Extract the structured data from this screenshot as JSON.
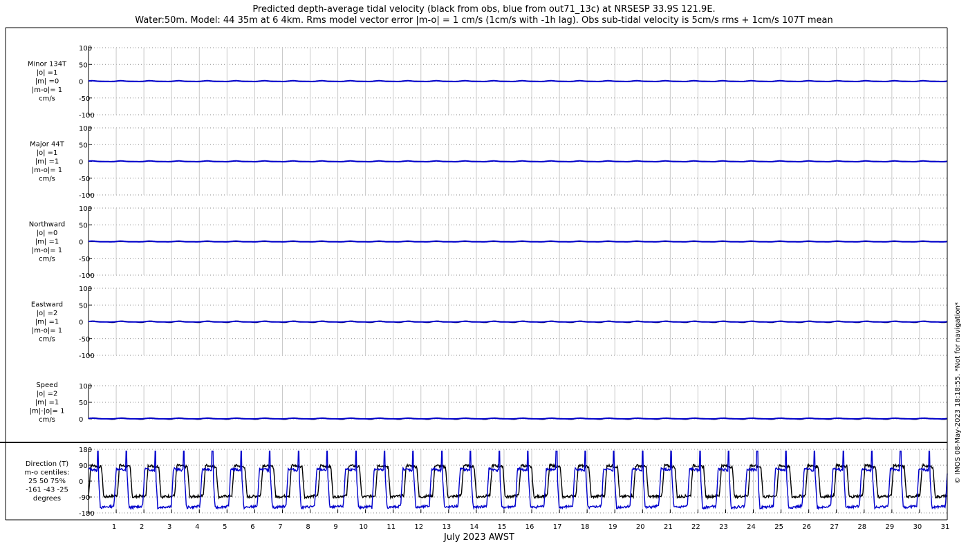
{
  "title": {
    "line1": "Predicted depth-average tidal velocity (black from obs, blue from out71_13c) at NRSESP 33.9S 121.9E.",
    "line2": "Water:50m. Model: 44 35m at 6 4km. Rms model vector error |m-o| = 1 cm/s (1cm/s with -1h lag). Obs sub-tidal velocity is 5cm/s rms + 1cm/s 107T mean"
  },
  "xlabel": "July 2023 AWST",
  "credit": "© IMOS 08-May-2023 18:18:55. *Not for navigation*",
  "colors": {
    "obs": "#000000",
    "model": "#0000cc",
    "grid": "#888888"
  },
  "chart_data": [
    {
      "type": "line",
      "name": "minor",
      "label_lines": [
        "Minor 134T",
        "|o| =1",
        "|m| =0",
        "|m-o|= 1",
        "cm/s"
      ],
      "ylim": [
        -100,
        100
      ],
      "yticks": [
        -100,
        -50,
        0,
        50,
        100
      ],
      "xlim": [
        0,
        31
      ],
      "xticks": [
        1,
        2,
        3,
        4,
        5,
        6,
        7,
        8,
        9,
        10,
        11,
        12,
        13,
        14,
        15,
        16,
        17,
        18,
        19,
        20,
        21,
        22,
        23,
        24,
        25,
        26,
        27,
        28,
        29,
        30,
        31
      ],
      "series": [
        {
          "role": "obs",
          "amplitude": 1
        },
        {
          "role": "model",
          "amplitude": 1
        }
      ]
    },
    {
      "type": "line",
      "name": "major",
      "label_lines": [
        "Major 44T",
        "|o| =1",
        "|m| =1",
        "|m-o|= 1",
        "cm/s"
      ],
      "ylim": [
        -100,
        100
      ],
      "yticks": [
        -100,
        -50,
        0,
        50,
        100
      ],
      "xlim": [
        0,
        31
      ],
      "xticks": [
        1,
        2,
        3,
        4,
        5,
        6,
        7,
        8,
        9,
        10,
        11,
        12,
        13,
        14,
        15,
        16,
        17,
        18,
        19,
        20,
        21,
        22,
        23,
        24,
        25,
        26,
        27,
        28,
        29,
        30,
        31
      ],
      "series": [
        {
          "role": "obs",
          "amplitude": 1
        },
        {
          "role": "model",
          "amplitude": 1
        }
      ]
    },
    {
      "type": "line",
      "name": "northward",
      "label_lines": [
        "Northward",
        "|o| =0",
        "|m| =1",
        "|m-o|= 1",
        "cm/s"
      ],
      "ylim": [
        -100,
        100
      ],
      "yticks": [
        -100,
        -50,
        0,
        50,
        100
      ],
      "xlim": [
        0,
        31
      ],
      "xticks": [
        1,
        2,
        3,
        4,
        5,
        6,
        7,
        8,
        9,
        10,
        11,
        12,
        13,
        14,
        15,
        16,
        17,
        18,
        19,
        20,
        21,
        22,
        23,
        24,
        25,
        26,
        27,
        28,
        29,
        30,
        31
      ],
      "series": [
        {
          "role": "obs",
          "amplitude": 0
        },
        {
          "role": "model",
          "amplitude": 1
        }
      ]
    },
    {
      "type": "line",
      "name": "eastward",
      "label_lines": [
        "Eastward",
        "|o| =2",
        "|m| =1",
        "|m-o|= 1",
        "cm/s"
      ],
      "ylim": [
        -100,
        100
      ],
      "yticks": [
        -100,
        -50,
        0,
        50,
        100
      ],
      "xlim": [
        0,
        31
      ],
      "xticks": [
        1,
        2,
        3,
        4,
        5,
        6,
        7,
        8,
        9,
        10,
        11,
        12,
        13,
        14,
        15,
        16,
        17,
        18,
        19,
        20,
        21,
        22,
        23,
        24,
        25,
        26,
        27,
        28,
        29,
        30,
        31
      ],
      "series": [
        {
          "role": "obs",
          "amplitude": 2
        },
        {
          "role": "model",
          "amplitude": 1
        }
      ]
    },
    {
      "type": "line",
      "name": "speed",
      "label_lines": [
        "Speed",
        "|o| =2",
        "|m| =1",
        "|m|-|o|= 1",
        "cm/s"
      ],
      "ylim": [
        0,
        100
      ],
      "yticks": [
        0,
        50,
        100
      ],
      "xlim": [
        0,
        31
      ],
      "xticks": [
        1,
        2,
        3,
        4,
        5,
        6,
        7,
        8,
        9,
        10,
        11,
        12,
        13,
        14,
        15,
        16,
        17,
        18,
        19,
        20,
        21,
        22,
        23,
        24,
        25,
        26,
        27,
        28,
        29,
        30,
        31
      ],
      "series": [
        {
          "role": "obs",
          "amplitude": 2
        },
        {
          "role": "model",
          "amplitude": 1
        }
      ]
    },
    {
      "type": "line",
      "name": "direction",
      "label_lines": [
        "Direction (T)",
        "m-o centiles:",
        "25  50  75%",
        "-161  -43  -25",
        "degrees"
      ],
      "ylim": [
        -180,
        180
      ],
      "yticks": [
        -180,
        -90,
        0,
        90,
        180
      ],
      "xlim": [
        0,
        31
      ],
      "xticks": [
        1,
        2,
        3,
        4,
        5,
        6,
        7,
        8,
        9,
        10,
        11,
        12,
        13,
        14,
        15,
        16,
        17,
        18,
        19,
        20,
        21,
        22,
        23,
        24,
        25,
        26,
        27,
        28,
        29,
        30,
        31
      ],
      "tidal_period_days": 1.035,
      "series": [
        {
          "role": "obs",
          "high": 90,
          "low": -90
        },
        {
          "role": "model",
          "high": 70,
          "low": -150
        }
      ]
    }
  ]
}
